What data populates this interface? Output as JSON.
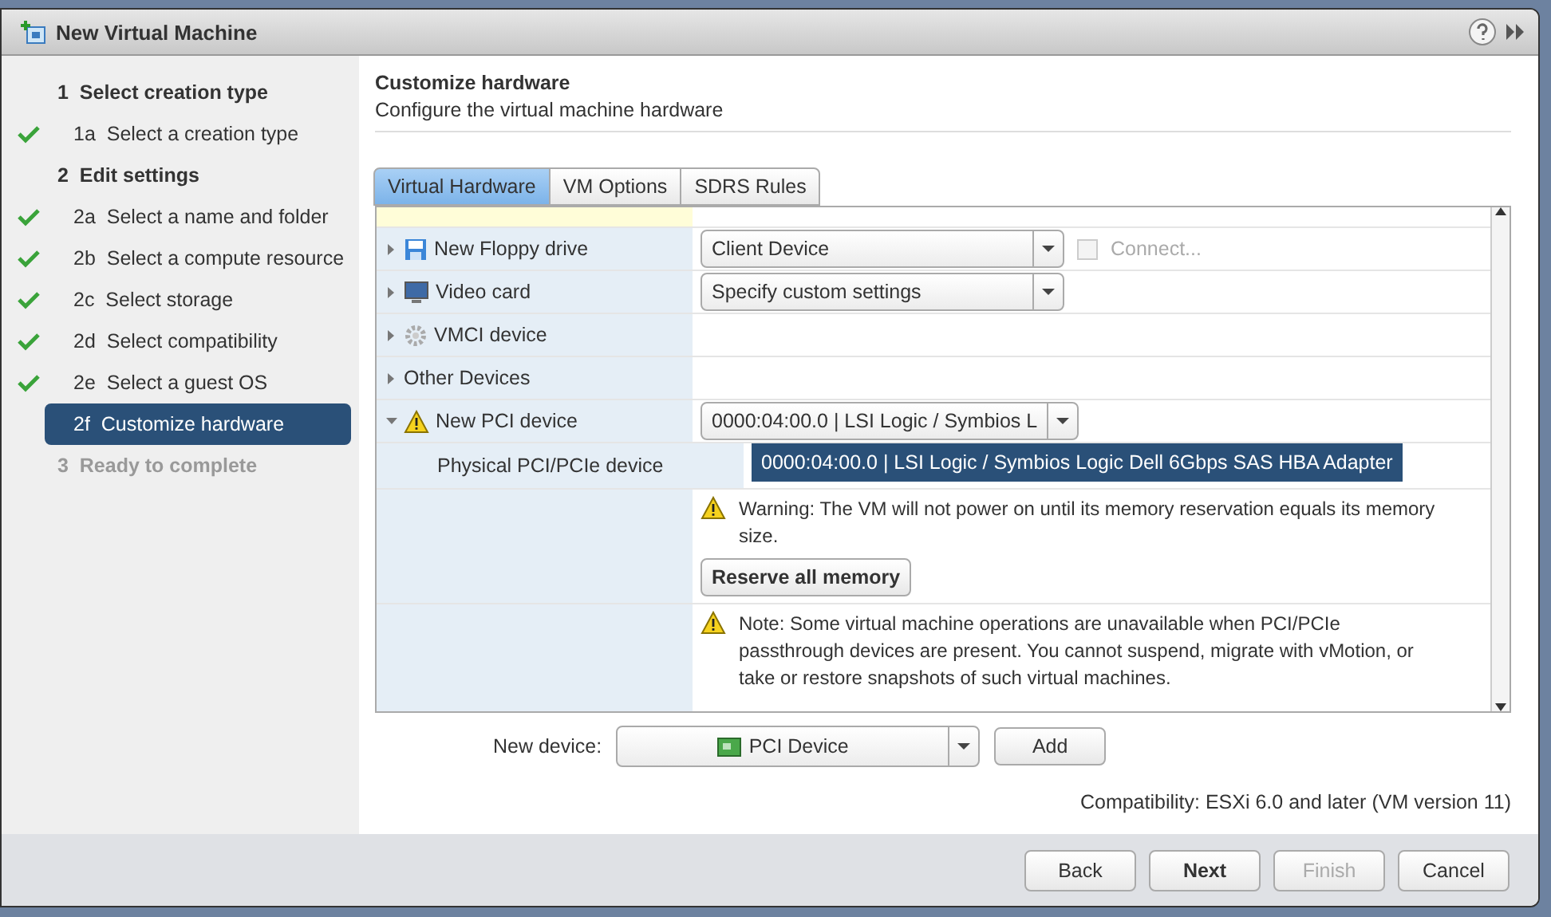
{
  "window": {
    "title": "New Virtual Machine"
  },
  "steps": [
    {
      "kind": "header",
      "number": "1",
      "label": "Select creation type",
      "done": false,
      "selected": false,
      "disabled": false
    },
    {
      "kind": "step",
      "number": "1a",
      "label": "Select a creation type",
      "done": true,
      "selected": false,
      "disabled": false
    },
    {
      "kind": "header",
      "number": "2",
      "label": "Edit settings",
      "done": false,
      "selected": false,
      "disabled": false
    },
    {
      "kind": "step",
      "number": "2a",
      "label": "Select a name and folder",
      "done": true,
      "selected": false,
      "disabled": false
    },
    {
      "kind": "step",
      "number": "2b",
      "label": "Select a compute resource",
      "done": true,
      "selected": false,
      "disabled": false
    },
    {
      "kind": "step",
      "number": "2c",
      "label": "Select storage",
      "done": true,
      "selected": false,
      "disabled": false
    },
    {
      "kind": "step",
      "number": "2d",
      "label": "Select compatibility",
      "done": true,
      "selected": false,
      "disabled": false
    },
    {
      "kind": "step",
      "number": "2e",
      "label": "Select a guest OS",
      "done": true,
      "selected": false,
      "disabled": false
    },
    {
      "kind": "step",
      "number": "2f",
      "label": "Customize hardware",
      "done": false,
      "selected": true,
      "disabled": false
    },
    {
      "kind": "header",
      "number": "3",
      "label": "Ready to complete",
      "done": false,
      "selected": false,
      "disabled": true
    }
  ],
  "page": {
    "title": "Customize hardware",
    "subtitle": "Configure the virtual machine hardware"
  },
  "tabs": [
    {
      "label": "Virtual Hardware",
      "selected": true
    },
    {
      "label": "VM Options",
      "selected": false
    },
    {
      "label": "SDRS Rules",
      "selected": false
    }
  ],
  "devices": [
    {
      "kind": "floppy",
      "label": "New Floppy drive",
      "expanded": false,
      "value": "Client Device",
      "checkbox": {
        "label": "Connect...",
        "checked": false,
        "disabled": true
      }
    },
    {
      "kind": "video",
      "label": "Video card",
      "expanded": false,
      "value": "Specify custom settings"
    },
    {
      "kind": "vmci",
      "label": "VMCI device",
      "expanded": false
    },
    {
      "kind": "other",
      "label": "Other Devices",
      "expanded": false
    },
    {
      "kind": "pci",
      "label": "New PCI device",
      "expanded": true,
      "value": "0000:04:00.0 | LSI Logic / Symbios L",
      "sub_label": "Physical PCI/PCIe device",
      "open_option": "0000:04:00.0 | LSI Logic / Symbios Logic Dell 6Gbps SAS HBA Adapter",
      "warning": "Warning: The VM will not power on until its memory reservation equals its memory size.",
      "action": "Reserve all memory",
      "note": "Note: Some virtual machine operations are unavailable when PCI/PCIe passthrough devices are present. You cannot suspend, migrate with vMotion, or take or restore snapshots of such virtual machines."
    }
  ],
  "new_device": {
    "label": "New device:",
    "value": "PCI Device",
    "button": "Add"
  },
  "compatibility": "Compatibility: ESXi 6.0 and later (VM version 11)",
  "buttons": [
    {
      "label": "Back",
      "primary": false,
      "disabled": false
    },
    {
      "label": "Next",
      "primary": true,
      "disabled": false
    },
    {
      "label": "Finish",
      "primary": false,
      "disabled": true
    },
    {
      "label": "Cancel",
      "primary": false,
      "disabled": false
    }
  ]
}
